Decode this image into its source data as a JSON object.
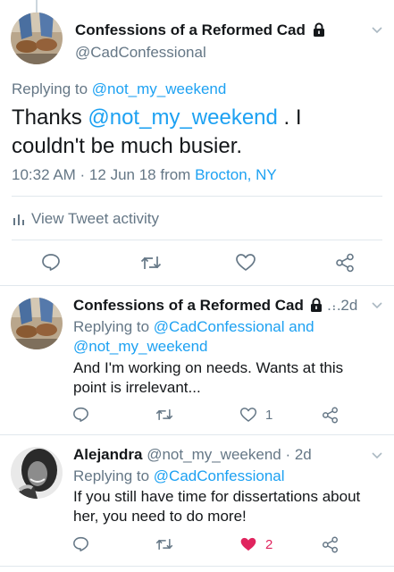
{
  "main_tweet": {
    "display_name": "Confessions of a Reformed Cad",
    "handle": "@CadConfessional",
    "replying_prefix": "Replying to",
    "replying_to": "@not_my_weekend",
    "text_prefix": "Thanks",
    "text_mention": "@not_my_weekend",
    "text_line1_suffix": ". I",
    "text_line2": "couldn't be much busier.",
    "timestamp": "10:32 AM · 12 Jun 18",
    "from_label": "from",
    "location": "Brocton, NY",
    "activity_label": "View Tweet activity"
  },
  "replies": [
    {
      "display_name": "Confessions of a Reformed Cad",
      "ellipsis": "…",
      "time": "· 2d",
      "replying_prefix": "Replying to",
      "replying_line1": "@CadConfessional and",
      "replying_line2": "@not_my_weekend",
      "text_line1": "And I'm working on needs. Wants at this",
      "text_line2": "point is irrelevant...",
      "like_count": "1"
    },
    {
      "display_name": "Alejandra",
      "handle": "@not_my_weekend",
      "time": "· 2d",
      "replying_prefix": "Replying to",
      "replying_to": "@CadConfessional",
      "text_line1": "If you still have time for dissertations about",
      "text_line2": "her, you need to do more!",
      "like_count": "2"
    }
  ],
  "colors": {
    "accent": "#1da1f2",
    "secondary_text": "#657786",
    "like_active": "#e0245e"
  }
}
